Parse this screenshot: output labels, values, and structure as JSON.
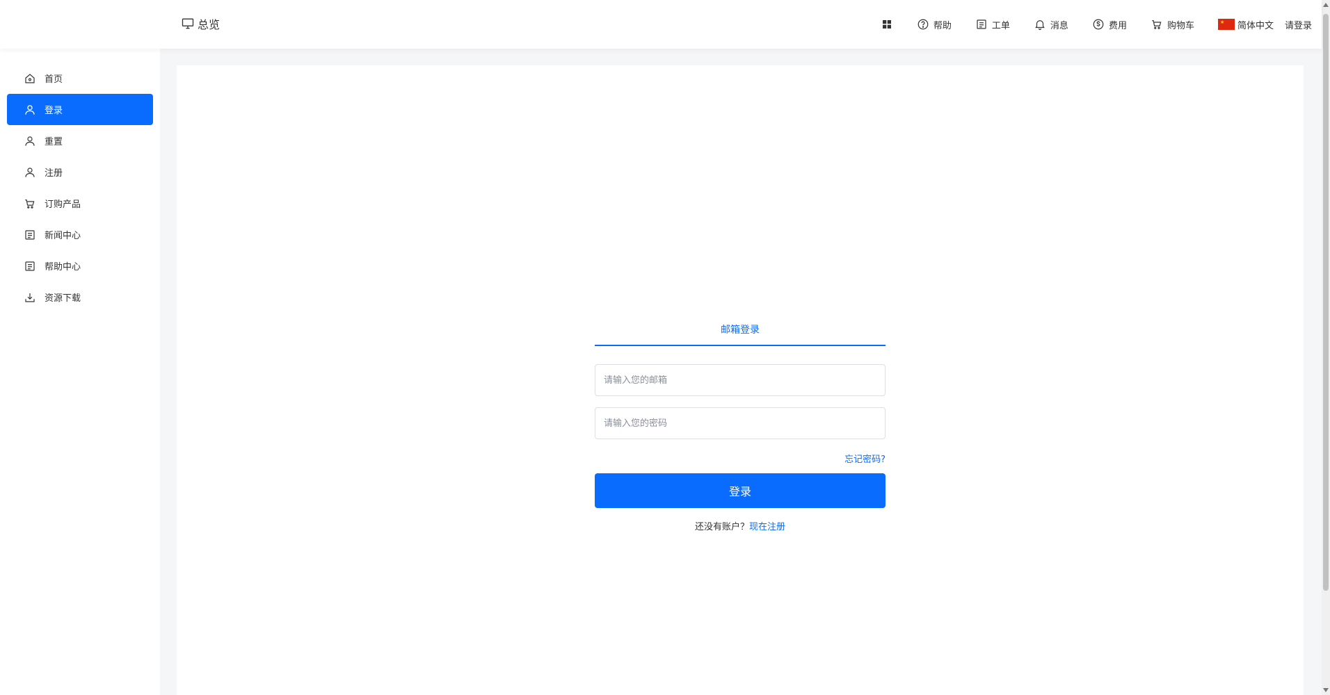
{
  "header": {
    "overview_label": "总览",
    "nav": {
      "help": "帮助",
      "ticket": "工单",
      "messages": "消息",
      "billing": "费用",
      "cart": "购物车",
      "language": "简体中文",
      "login": "请登录"
    }
  },
  "sidebar": {
    "items": [
      {
        "label": "首页",
        "icon": "home-icon"
      },
      {
        "label": "登录",
        "icon": "user-icon",
        "active": true
      },
      {
        "label": "重置",
        "icon": "user-icon"
      },
      {
        "label": "注册",
        "icon": "user-icon"
      },
      {
        "label": "订购产品",
        "icon": "cart-icon"
      },
      {
        "label": "新闻中心",
        "icon": "document-icon"
      },
      {
        "label": "帮助中心",
        "icon": "document-icon"
      },
      {
        "label": "资源下载",
        "icon": "download-icon"
      }
    ]
  },
  "login": {
    "tab_label": "邮箱登录",
    "email_placeholder": "请输入您的邮箱",
    "password_placeholder": "请输入您的密码",
    "forgot_label": "忘记密码?",
    "submit_label": "登录",
    "no_account_text": "还没有账户？",
    "register_link": "现在注册"
  },
  "colors": {
    "accent": "#0a6cff",
    "background": "#f5f6f8"
  }
}
